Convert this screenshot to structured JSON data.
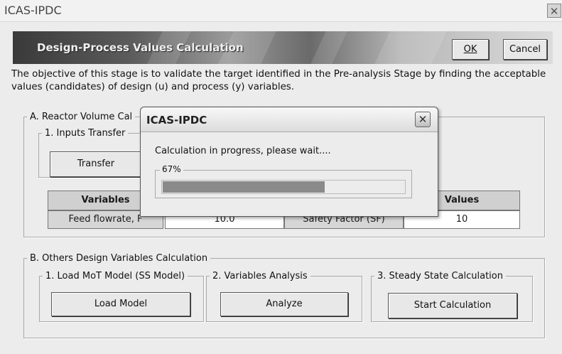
{
  "window": {
    "title": "ICAS-IPDC",
    "close_glyph": "✕"
  },
  "banner": {
    "title": "Design-Process Values Calculation"
  },
  "buttons": {
    "ok": "OK",
    "cancel": "Cancel"
  },
  "objective": "The objective of this stage is to validate the target identified in the Pre-analysis Stage by finding the acceptable values (candidates) of design (u) and process (y) variables.",
  "section_a": {
    "legend": "A. Reactor Volume Cal",
    "inputs_legend": "1. Inputs Transfer",
    "transfer_button": "Transfer",
    "table": {
      "headers": [
        "Variables",
        "Values"
      ],
      "row": {
        "variable": "Feed flowrate, F",
        "value": "10.0",
        "factor_label": "Safety Factor (SF)",
        "factor_value": "10"
      }
    }
  },
  "section_b": {
    "legend": "B. Others Design Variables Calculation",
    "groups": [
      {
        "legend": "1. Load MoT Model (SS Model)",
        "button": "Load Model"
      },
      {
        "legend": "2. Variables Analysis",
        "button": "Analyze"
      },
      {
        "legend": "3. Steady State Calculation",
        "button": "Start Calculation"
      }
    ]
  },
  "dialog": {
    "title": "ICAS-IPDC",
    "message": "Calculation in progress, please wait....",
    "progress_label": "67%",
    "progress": 0.67,
    "close_glyph": "✕"
  },
  "colors": {
    "window_bg": "#ececec",
    "progress_fill": "#8a8a8a"
  }
}
